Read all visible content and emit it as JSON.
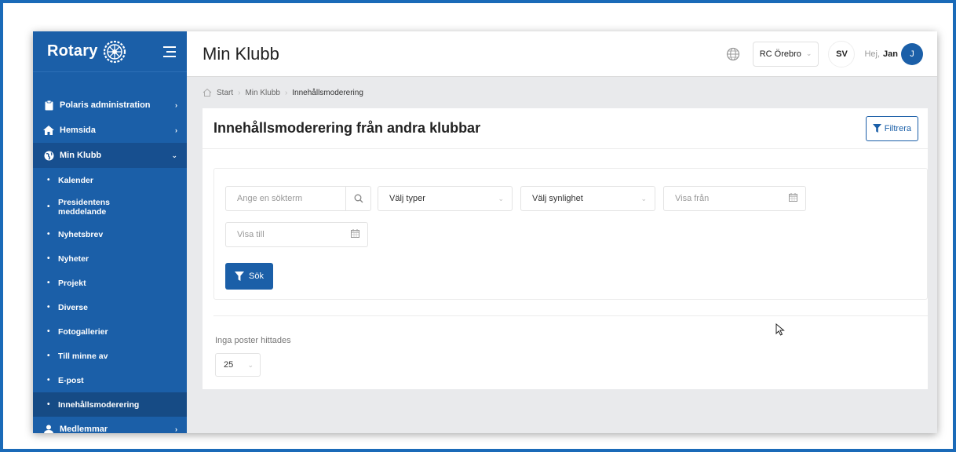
{
  "brand": {
    "name": "Rotary"
  },
  "sidebar": {
    "items": [
      {
        "label": "Polaris administration",
        "icon": "clipboard-icon"
      },
      {
        "label": "Hemsida",
        "icon": "home-icon"
      },
      {
        "label": "Min Klubb",
        "icon": "globe-icon"
      }
    ],
    "sub_items": [
      "Kalender",
      "Presidentens meddelande",
      "Nyhetsbrev",
      "Nyheter",
      "Projekt",
      "Diverse",
      "Fotogallerier",
      "Till minne av",
      "E-post",
      "Innehållsmoderering"
    ],
    "bottom_item": {
      "label": "Medlemmar",
      "icon": "user-icon"
    }
  },
  "header": {
    "title": "Min Klubb",
    "club": "RC Örebro",
    "language": "SV",
    "greeting": "Hej,",
    "user_name": "Jan",
    "avatar_initial": "J"
  },
  "breadcrumb": {
    "start": "Start",
    "parent": "Min Klubb",
    "current": "Innehållsmoderering"
  },
  "card": {
    "title": "Innehållsmoderering från andra klubbar",
    "filter_button": "Filtrera"
  },
  "filters": {
    "search_placeholder": "Ange en sökterm",
    "types_placeholder": "Välj typer",
    "visibility_placeholder": "Välj synlighet",
    "from_placeholder": "Visa från",
    "to_placeholder": "Visa till",
    "search_button": "Sök"
  },
  "results": {
    "empty_message": "Inga poster hittades",
    "page_size": "25"
  },
  "colors": {
    "accent": "#1b5fa8",
    "frame": "#1a6ab8"
  }
}
